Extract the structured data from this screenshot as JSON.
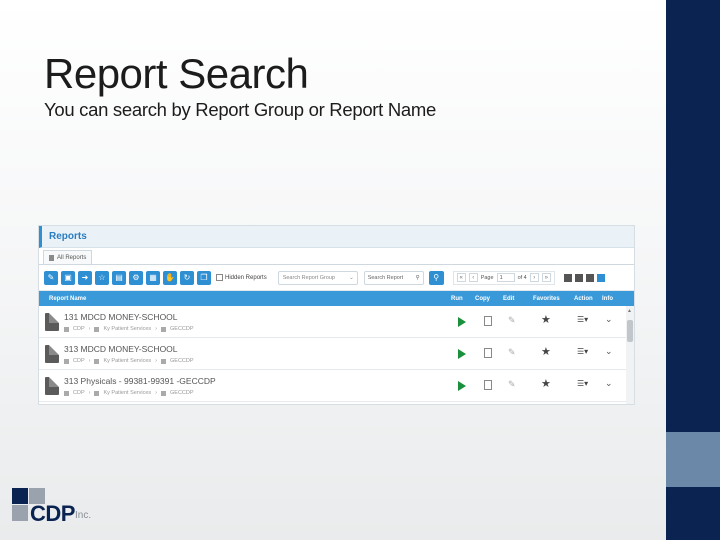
{
  "slide": {
    "title": "Report Search",
    "subtitle": "You can search by Report Group or Report Name"
  },
  "app": {
    "header": "Reports",
    "tab": "All Reports",
    "toolbar": {
      "hidden_reports_label": "Hidden Reports",
      "group_placeholder": "Search Report Group",
      "name_placeholder": "Search Report",
      "page_label": "Page",
      "page_value": "1",
      "page_of": "of 4"
    },
    "columns": {
      "name": "Report Name",
      "run": "Run",
      "copy": "Copy",
      "edit": "Edit",
      "favorites": "Favorites",
      "action": "Action",
      "info": "Info"
    },
    "rows": [
      {
        "name": "131 MDCD MONEY-SCHOOL",
        "path": [
          "CDP",
          "Ky Patient Services",
          "GECCDP"
        ]
      },
      {
        "name": "313 MDCD MONEY-SCHOOL",
        "path": [
          "CDP",
          "Ky Patient Services",
          "GECCDP"
        ]
      },
      {
        "name": "313 Physicals - 99381-99391 -GECCDP",
        "path": [
          "CDP",
          "Ky Patient Services",
          "GECCDP"
        ]
      }
    ],
    "colors": {
      "accent": "#2e8fd3",
      "run": "#1a8f3c",
      "header": "#3a9ad9"
    }
  },
  "logo": {
    "brand": "CDP",
    "suffix": "Inc."
  }
}
